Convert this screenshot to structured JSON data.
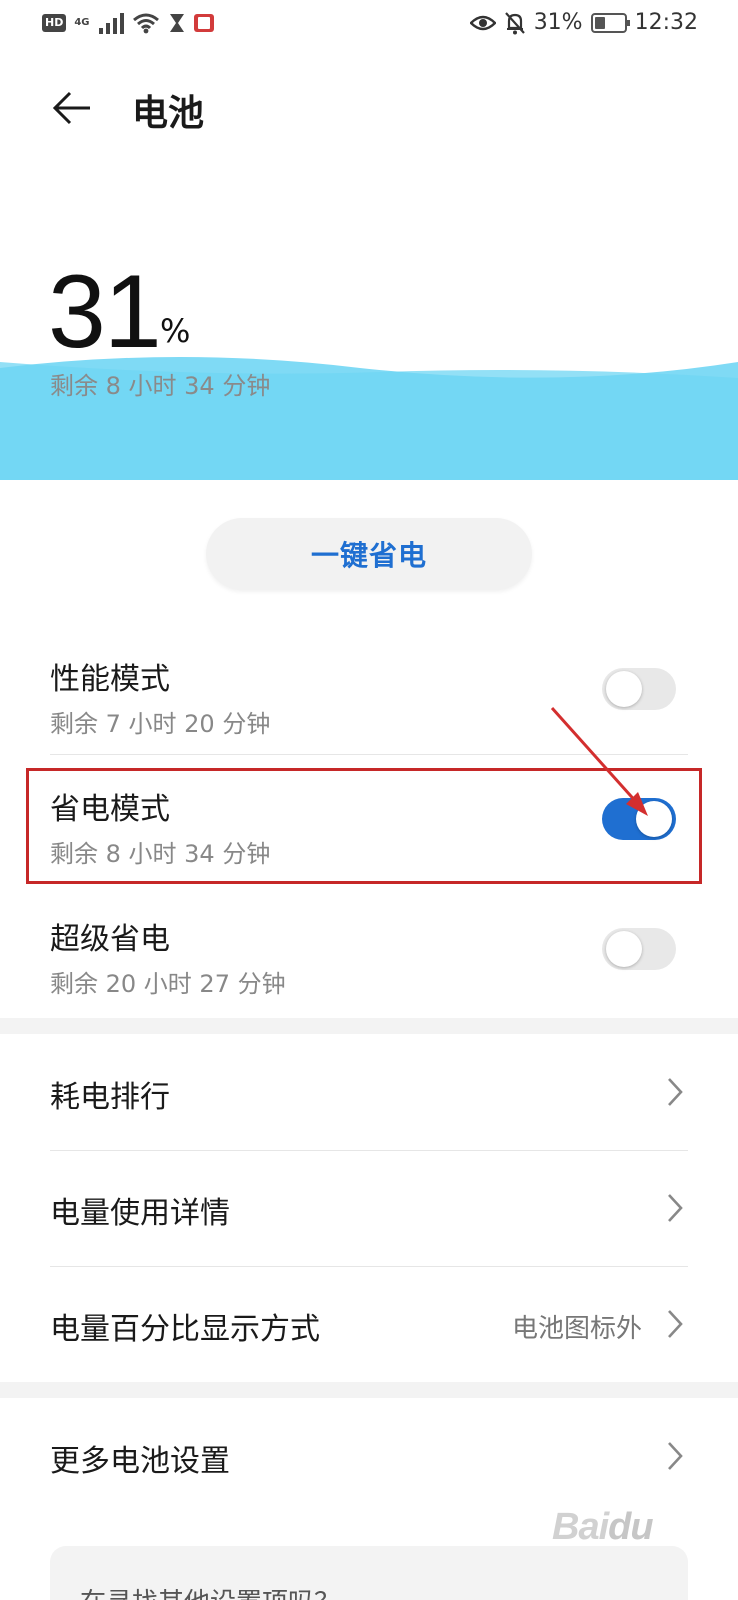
{
  "status_bar": {
    "hd": "HD",
    "network": "4G",
    "battery_percent": "31%",
    "time": "12:32",
    "icons": [
      "hd-icon",
      "signal-icon",
      "wifi-icon",
      "hourglass-icon",
      "book-icon",
      "eye-icon",
      "bell-off-icon",
      "battery-icon"
    ]
  },
  "header": {
    "title": "电池"
  },
  "battery": {
    "percent": "31",
    "unit": "%",
    "remaining": "剩余 8 小时 34 分钟",
    "level": 0.31
  },
  "one_tap": {
    "label": "一键省电"
  },
  "modes": [
    {
      "title": "性能模式",
      "remaining": "剩余 7 小时 20 分钟",
      "enabled": false
    },
    {
      "title": "省电模式",
      "remaining": "剩余 8 小时 34 分钟",
      "enabled": true
    },
    {
      "title": "超级省电",
      "remaining": "剩余 20 小时 27 分钟",
      "enabled": false
    }
  ],
  "settings": [
    {
      "label": "耗电排行",
      "value": ""
    },
    {
      "label": "电量使用详情",
      "value": ""
    },
    {
      "label": "电量百分比显示方式",
      "value": "电池图标外"
    }
  ],
  "more": {
    "label": "更多电池设置"
  },
  "hint": {
    "text": "在寻找其他设置项吗？"
  },
  "colors": {
    "accent": "#1f6fd1",
    "wave": "#7fdaf5",
    "highlight": "#c62828"
  }
}
